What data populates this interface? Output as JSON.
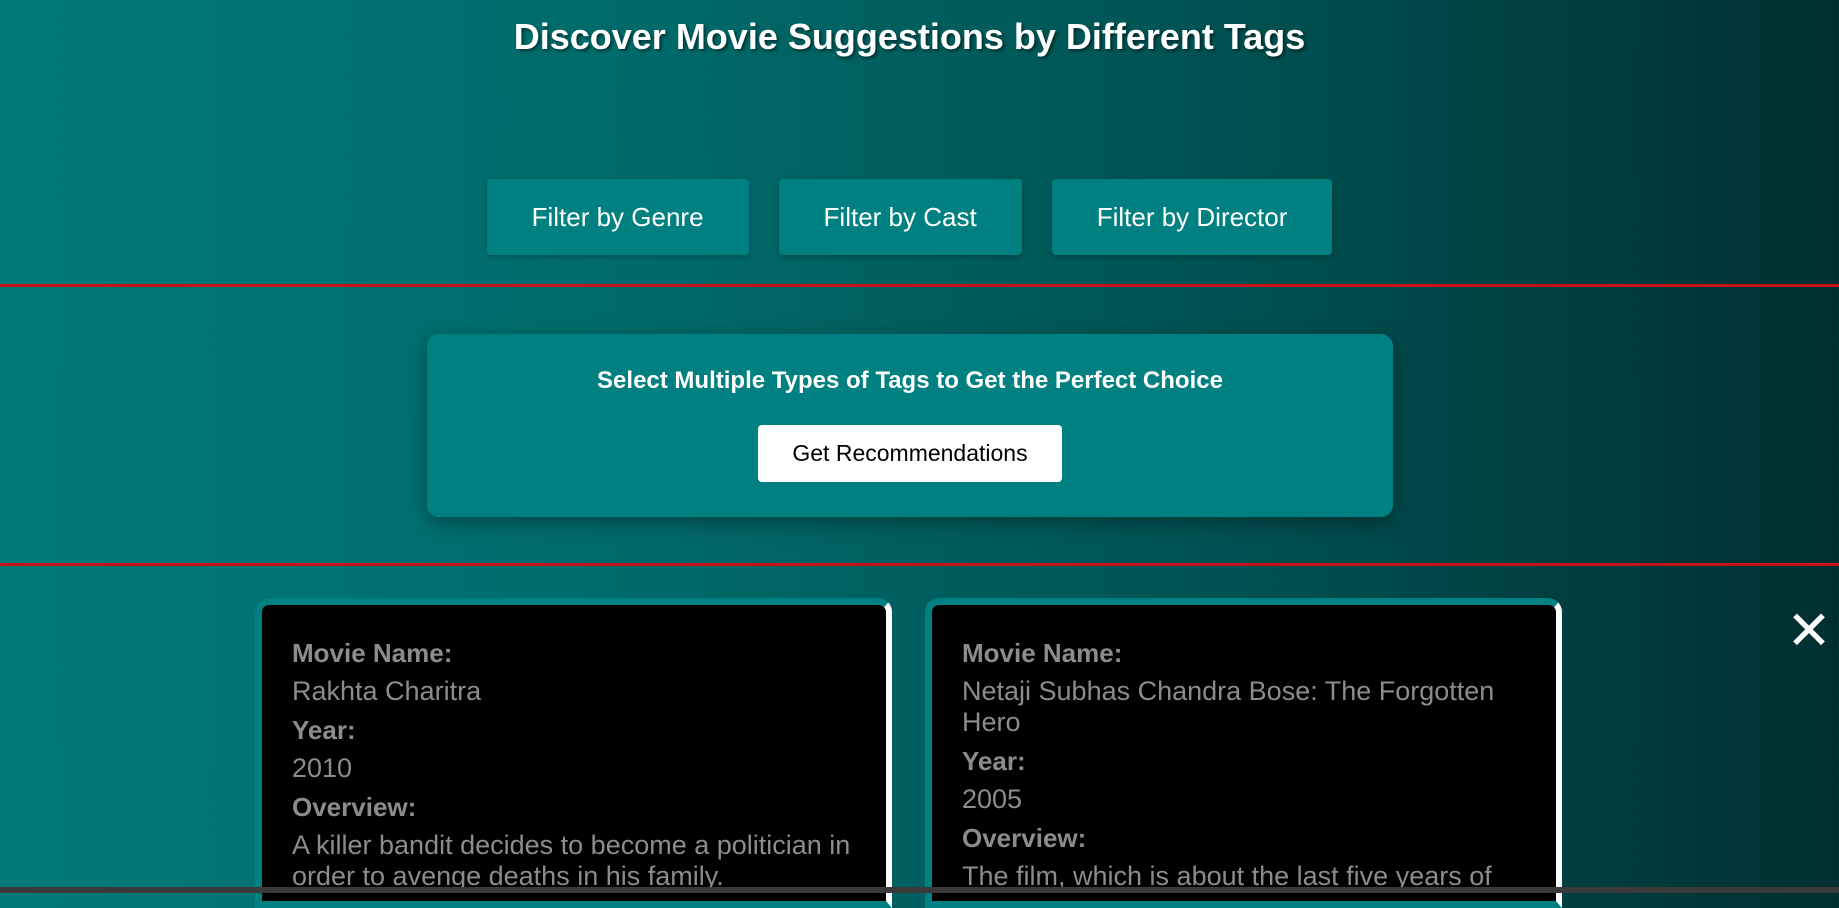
{
  "header": {
    "title": "Discover Movie Suggestions by Different Tags"
  },
  "filters": [
    {
      "label": "Filter by Genre"
    },
    {
      "label": "Filter by Cast"
    },
    {
      "label": "Filter by Director"
    }
  ],
  "panel": {
    "heading": "Select Multiple Types of Tags to Get the Perfect Choice",
    "button_label": "Get Recommendations"
  },
  "labels": {
    "name": "Movie Name:",
    "year": "Year:",
    "overview": "Overview:"
  },
  "movies": [
    {
      "name": "Rakhta Charitra",
      "year": "2010",
      "overview": "A killer bandit decides to become a politician in order to avenge deaths in his family."
    },
    {
      "name": "Netaji Subhas Chandra Bose: The Forgotten Hero",
      "year": "2005",
      "overview": "The film, which is about the last five years of"
    }
  ],
  "close": {
    "icon": "close-icon",
    "glyph": "✕"
  },
  "colors": {
    "accent": "#008080",
    "divider": "#c8121b",
    "card_bg": "#000000",
    "card_text": "#8c8c8c"
  }
}
